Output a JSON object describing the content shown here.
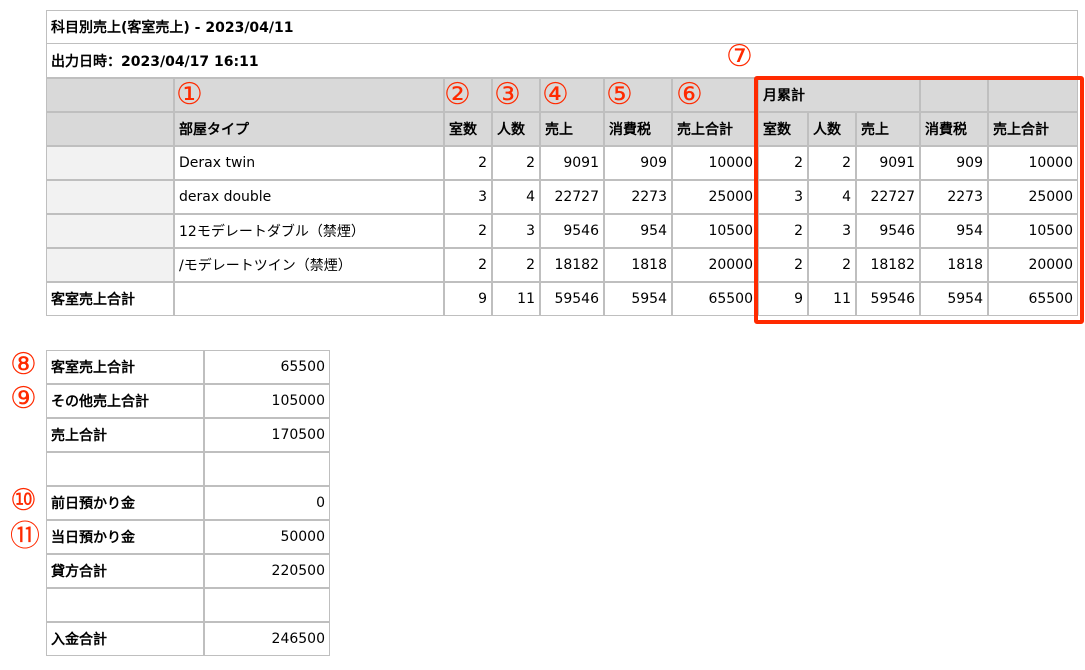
{
  "report": {
    "title": "科目別売上(客室売上) - 2023/04/11",
    "output_datetime": "出力日時：2023/04/17 16:11"
  },
  "main_table": {
    "markers": [
      "①",
      "②",
      "③",
      "④",
      "⑤",
      "⑥",
      "⑦"
    ],
    "group_header": "月累計",
    "headers": [
      "部屋タイプ",
      "室数",
      "人数",
      "売上",
      "消費税",
      "売上合計",
      "室数",
      "人数",
      "売上",
      "消費税",
      "売上合計"
    ],
    "rows": [
      {
        "type": "Derax twin",
        "rooms": "2",
        "people": "2",
        "sales": "9091",
        "tax": "909",
        "total": "10000",
        "m_rooms": "2",
        "m_people": "2",
        "m_sales": "9091",
        "m_tax": "909",
        "m_total": "10000"
      },
      {
        "type": "derax double",
        "rooms": "3",
        "people": "4",
        "sales": "22727",
        "tax": "2273",
        "total": "25000",
        "m_rooms": "3",
        "m_people": "4",
        "m_sales": "22727",
        "m_tax": "2273",
        "m_total": "25000"
      },
      {
        "type": "12モデレートダブル（禁煙）",
        "rooms": "2",
        "people": "3",
        "sales": "9546",
        "tax": "954",
        "total": "10500",
        "m_rooms": "2",
        "m_people": "3",
        "m_sales": "9546",
        "m_tax": "954",
        "m_total": "10500"
      },
      {
        "type": "/モデレートツイン（禁煙）",
        "rooms": "2",
        "people": "2",
        "sales": "18182",
        "tax": "1818",
        "total": "20000",
        "m_rooms": "2",
        "m_people": "2",
        "m_sales": "18182",
        "m_tax": "1818",
        "m_total": "20000"
      }
    ],
    "total_row": {
      "label": "客室売上合計",
      "rooms": "9",
      "people": "11",
      "sales": "59546",
      "tax": "5954",
      "total": "65500",
      "m_rooms": "9",
      "m_people": "11",
      "m_sales": "59546",
      "m_tax": "5954",
      "m_total": "65500"
    }
  },
  "summary": {
    "markers": [
      "⑧",
      "⑨",
      "⑩",
      "⑪"
    ],
    "rows": [
      {
        "label": "客室売上合計",
        "value": "65500"
      },
      {
        "label": "その他売上合計",
        "value": "105000"
      },
      {
        "label": "売上合計",
        "value": "170500"
      },
      {
        "label": "",
        "value": ""
      },
      {
        "label": "前日預かり金",
        "value": "0"
      },
      {
        "label": "当日預かり金",
        "value": "50000"
      },
      {
        "label": "貸方合計",
        "value": "220500"
      },
      {
        "label": "",
        "value": ""
      },
      {
        "label": "入金合計",
        "value": "246500"
      }
    ]
  },
  "colors": {
    "marker": "#ff2a00",
    "header_bg": "#d9d9d9",
    "border": "#bfbfbf"
  }
}
